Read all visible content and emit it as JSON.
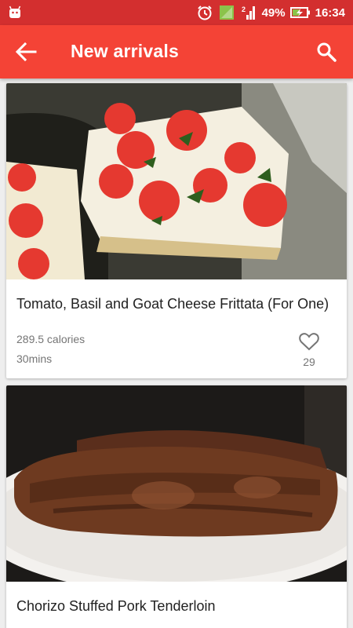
{
  "status_bar": {
    "battery": "49%",
    "time": "16:34",
    "signal_label": "2",
    "icons": [
      "android-notification-icon",
      "alarm-icon",
      "signal-icon",
      "battery-charging-icon"
    ]
  },
  "app_bar": {
    "title": "New arrivals",
    "back_icon": "arrow-back-icon",
    "search_icon": "search-icon",
    "color": "#f44336",
    "status_color": "#d32f2f"
  },
  "recipes": [
    {
      "name": "Tomato, Basil and Goat Cheese Frittata (For One)",
      "calories": "289.5 calories",
      "time": "30mins",
      "favorites": "29",
      "image": "frittata-photo"
    },
    {
      "name": "Chorizo Stuffed Pork Tenderloin",
      "image": "pork-tenderloin-photo"
    }
  ]
}
